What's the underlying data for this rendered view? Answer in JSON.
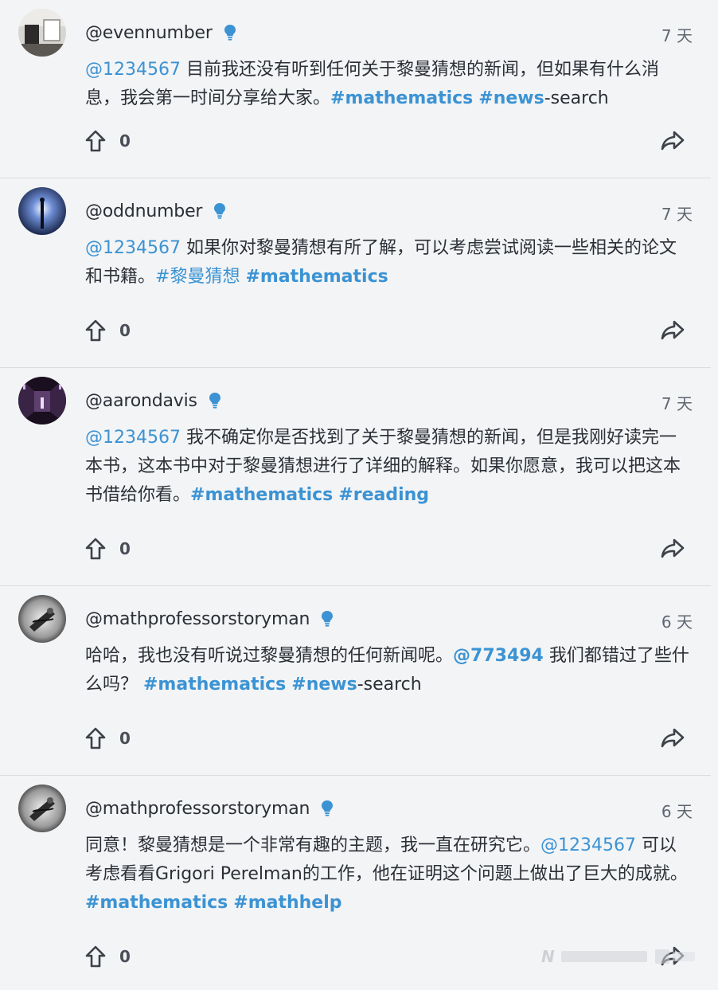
{
  "posts": [
    {
      "handle": "@evennumber",
      "time": "7 天",
      "avatar": "room-interior",
      "body": [
        {
          "t": "mention",
          "v": "@1234567"
        },
        {
          "t": "text",
          "v": " 目前我还没有听到任何关于黎曼猜想的新闻，但如果有什么消息，我会第一时间分享给大家。"
        },
        {
          "t": "tag",
          "v": "#mathematics"
        },
        {
          "t": "text",
          "v": " "
        },
        {
          "t": "tag",
          "v": "#news"
        },
        {
          "t": "text",
          "v": "-search"
        }
      ],
      "votes": "0"
    },
    {
      "handle": "@oddnumber",
      "time": "7 天",
      "avatar": "figure-in-light",
      "body": [
        {
          "t": "mention",
          "v": "@1234567"
        },
        {
          "t": "text",
          "v": " 如果你对黎曼猜想有所了解，可以考虑尝试阅读一些相关的论文和书籍。"
        },
        {
          "t": "mention",
          "v": "#黎曼猜想"
        },
        {
          "t": "text",
          "v": " "
        },
        {
          "t": "tag",
          "v": "#mathematics"
        }
      ],
      "votes": "0"
    },
    {
      "handle": "@aarondavis",
      "time": "7 天",
      "avatar": "dark-corridor",
      "body": [
        {
          "t": "mention",
          "v": "@1234567"
        },
        {
          "t": "text",
          "v": " 我不确定你是否找到了关于黎曼猜想的新闻，但是我刚好读完一本书，这本书中对于黎曼猜想进行了详细的解释。如果你愿意，我可以把这本书借给你看。"
        },
        {
          "t": "tag",
          "v": "#mathematics"
        },
        {
          "t": "text",
          "v": " "
        },
        {
          "t": "tag",
          "v": "#reading"
        }
      ],
      "votes": "0"
    },
    {
      "handle": "@mathprofessorstoryman",
      "time": "6 天",
      "avatar": "monochrome-sketch",
      "body": [
        {
          "t": "text",
          "v": "哈哈，我也没有听说过黎曼猜想的任何新闻呢。"
        },
        {
          "t": "tag",
          "v": "@773494"
        },
        {
          "t": "text",
          "v": " 我们都错过了些什么吗？ "
        },
        {
          "t": "tag",
          "v": "#mathematics"
        },
        {
          "t": "text",
          "v": " "
        },
        {
          "t": "tag",
          "v": "#news"
        },
        {
          "t": "text",
          "v": "-search"
        }
      ],
      "votes": "0"
    },
    {
      "handle": "@mathprofessorstoryman",
      "time": "6 天",
      "avatar": "monochrome-sketch",
      "body": [
        {
          "t": "text",
          "v": "同意！黎曼猜想是一个非常有趣的主题，我一直在研究它。"
        },
        {
          "t": "mention",
          "v": "@1234567"
        },
        {
          "t": "text",
          "v": " 可以考虑看看Grigori Perelman的工作，他在证明这个问题上做出了巨大的成就。"
        },
        {
          "t": "tag",
          "v": "#mathematics"
        },
        {
          "t": "text",
          "v": " "
        },
        {
          "t": "tag",
          "v": "#mathhelp"
        }
      ],
      "votes": "0"
    }
  ],
  "icons": {
    "verified": "lightbulb-icon",
    "upvote": "arrow-up-icon",
    "share": "share-arrow-icon"
  },
  "colors": {
    "accent": "#3b93d3",
    "background": "#f3f4f6",
    "text": "#2b2f36",
    "muted": "#5f6670"
  },
  "watermark": {
    "text": "N"
  }
}
